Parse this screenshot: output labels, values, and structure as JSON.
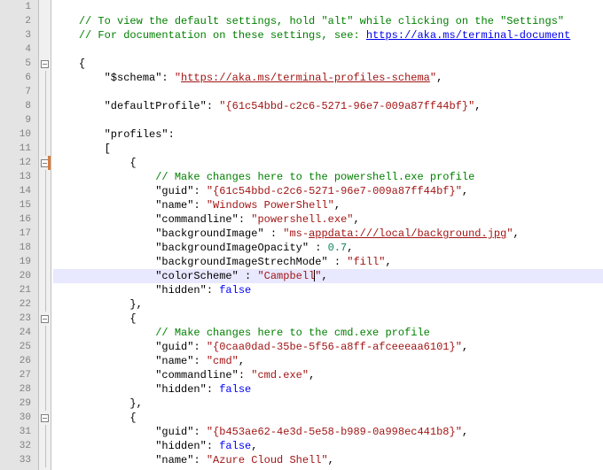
{
  "chart_data": null,
  "lines": [
    {
      "n": 1,
      "fold": "",
      "mark": "",
      "html": ""
    },
    {
      "n": 2,
      "fold": "",
      "mark": "",
      "seg": [
        {
          "cls": "",
          "t": "    "
        },
        {
          "cls": "comment",
          "t": "// To view the default settings, hold \"alt\" while clicking on the \"Settings\""
        }
      ]
    },
    {
      "n": 3,
      "fold": "",
      "mark": "",
      "seg": [
        {
          "cls": "",
          "t": "    "
        },
        {
          "cls": "comment",
          "t": "// For documentation on these settings, see: "
        },
        {
          "cls": "comment link",
          "t": "https://aka.ms/terminal-document"
        }
      ]
    },
    {
      "n": 4,
      "fold": "",
      "mark": "",
      "seg": []
    },
    {
      "n": 5,
      "fold": "box",
      "mark": "",
      "seg": [
        {
          "cls": "",
          "t": "    "
        },
        {
          "cls": "punct",
          "t": "{"
        }
      ]
    },
    {
      "n": 6,
      "fold": "line",
      "mark": "",
      "seg": [
        {
          "cls": "",
          "t": "        "
        },
        {
          "cls": "key",
          "t": "\"$schema\""
        },
        {
          "cls": "punct",
          "t": ": "
        },
        {
          "cls": "str",
          "t": "\""
        },
        {
          "cls": "keylink",
          "t": "https://aka.ms/terminal-profiles-schema"
        },
        {
          "cls": "str",
          "t": "\""
        },
        {
          "cls": "punct",
          "t": ","
        }
      ]
    },
    {
      "n": 7,
      "fold": "line",
      "mark": "",
      "seg": []
    },
    {
      "n": 8,
      "fold": "line",
      "mark": "",
      "seg": [
        {
          "cls": "",
          "t": "        "
        },
        {
          "cls": "key",
          "t": "\"defaultProfile\""
        },
        {
          "cls": "punct",
          "t": ": "
        },
        {
          "cls": "str",
          "t": "\"{61c54bbd-c2c6-5271-96e7-009a87ff44bf}\""
        },
        {
          "cls": "punct",
          "t": ","
        }
      ]
    },
    {
      "n": 9,
      "fold": "line",
      "mark": "",
      "seg": []
    },
    {
      "n": 10,
      "fold": "line",
      "mark": "",
      "seg": [
        {
          "cls": "",
          "t": "        "
        },
        {
          "cls": "key",
          "t": "\"profiles\""
        },
        {
          "cls": "punct",
          "t": ":"
        }
      ]
    },
    {
      "n": 11,
      "fold": "line",
      "mark": "",
      "seg": [
        {
          "cls": "",
          "t": "        "
        },
        {
          "cls": "punct",
          "t": "["
        }
      ]
    },
    {
      "n": 12,
      "fold": "box",
      "mark": "changed",
      "seg": [
        {
          "cls": "",
          "t": "            "
        },
        {
          "cls": "punct",
          "t": "{"
        }
      ]
    },
    {
      "n": 13,
      "fold": "line",
      "mark": "",
      "seg": [
        {
          "cls": "",
          "t": "                "
        },
        {
          "cls": "comment",
          "t": "// Make changes here to the powershell.exe profile"
        }
      ]
    },
    {
      "n": 14,
      "fold": "line",
      "mark": "",
      "seg": [
        {
          "cls": "",
          "t": "                "
        },
        {
          "cls": "key",
          "t": "\"guid\""
        },
        {
          "cls": "punct",
          "t": ": "
        },
        {
          "cls": "str",
          "t": "\"{61c54bbd-c2c6-5271-96e7-009a87ff44bf}\""
        },
        {
          "cls": "punct",
          "t": ","
        }
      ]
    },
    {
      "n": 15,
      "fold": "line",
      "mark": "",
      "seg": [
        {
          "cls": "",
          "t": "                "
        },
        {
          "cls": "key",
          "t": "\"name\""
        },
        {
          "cls": "punct",
          "t": ": "
        },
        {
          "cls": "str",
          "t": "\"Windows PowerShell\""
        },
        {
          "cls": "punct",
          "t": ","
        }
      ]
    },
    {
      "n": 16,
      "fold": "line",
      "mark": "",
      "seg": [
        {
          "cls": "",
          "t": "                "
        },
        {
          "cls": "key",
          "t": "\"commandline\""
        },
        {
          "cls": "punct",
          "t": ": "
        },
        {
          "cls": "str",
          "t": "\"powershell.exe\""
        },
        {
          "cls": "punct",
          "t": ","
        }
      ]
    },
    {
      "n": 17,
      "fold": "line",
      "mark": "",
      "seg": [
        {
          "cls": "",
          "t": "                "
        },
        {
          "cls": "key",
          "t": "\"backgroundImage\""
        },
        {
          "cls": "punct",
          "t": " : "
        },
        {
          "cls": "str",
          "t": "\"ms-"
        },
        {
          "cls": "keylink",
          "t": "appdata:///local/background.jpg"
        },
        {
          "cls": "str",
          "t": "\""
        },
        {
          "cls": "punct",
          "t": ","
        }
      ]
    },
    {
      "n": 18,
      "fold": "line",
      "mark": "",
      "seg": [
        {
          "cls": "",
          "t": "                "
        },
        {
          "cls": "key",
          "t": "\"backgroundImageOpacity\""
        },
        {
          "cls": "punct",
          "t": " : "
        },
        {
          "cls": "num",
          "t": "0.7"
        },
        {
          "cls": "punct",
          "t": ","
        }
      ]
    },
    {
      "n": 19,
      "fold": "line",
      "mark": "",
      "seg": [
        {
          "cls": "",
          "t": "                "
        },
        {
          "cls": "key",
          "t": "\"backgroundImageStrechMode\""
        },
        {
          "cls": "punct",
          "t": " : "
        },
        {
          "cls": "str",
          "t": "\"fill\""
        },
        {
          "cls": "punct",
          "t": ","
        }
      ]
    },
    {
      "n": 20,
      "fold": "line",
      "mark": "",
      "hl": true,
      "caret": true,
      "seg": [
        {
          "cls": "",
          "t": "                "
        },
        {
          "cls": "key",
          "t": "\"colorScheme\""
        },
        {
          "cls": "punct",
          "t": " : "
        },
        {
          "cls": "str",
          "t": "\"Campbell"
        },
        {
          "cls": "caretmark",
          "t": ""
        },
        {
          "cls": "str",
          "t": "\""
        },
        {
          "cls": "punct",
          "t": ","
        }
      ]
    },
    {
      "n": 21,
      "fold": "line",
      "mark": "",
      "seg": [
        {
          "cls": "",
          "t": "                "
        },
        {
          "cls": "key",
          "t": "\"hidden\""
        },
        {
          "cls": "punct",
          "t": ": "
        },
        {
          "cls": "bool",
          "t": "false"
        }
      ]
    },
    {
      "n": 22,
      "fold": "line",
      "mark": "",
      "seg": [
        {
          "cls": "",
          "t": "            "
        },
        {
          "cls": "punct",
          "t": "},"
        }
      ]
    },
    {
      "n": 23,
      "fold": "box",
      "mark": "",
      "seg": [
        {
          "cls": "",
          "t": "            "
        },
        {
          "cls": "punct",
          "t": "{"
        }
      ]
    },
    {
      "n": 24,
      "fold": "line",
      "mark": "",
      "seg": [
        {
          "cls": "",
          "t": "                "
        },
        {
          "cls": "comment",
          "t": "// Make changes here to the cmd.exe profile"
        }
      ]
    },
    {
      "n": 25,
      "fold": "line",
      "mark": "",
      "seg": [
        {
          "cls": "",
          "t": "                "
        },
        {
          "cls": "key",
          "t": "\"guid\""
        },
        {
          "cls": "punct",
          "t": ": "
        },
        {
          "cls": "str",
          "t": "\"{0caa0dad-35be-5f56-a8ff-afceeeaa6101}\""
        },
        {
          "cls": "punct",
          "t": ","
        }
      ]
    },
    {
      "n": 26,
      "fold": "line",
      "mark": "",
      "seg": [
        {
          "cls": "",
          "t": "                "
        },
        {
          "cls": "key",
          "t": "\"name\""
        },
        {
          "cls": "punct",
          "t": ": "
        },
        {
          "cls": "str",
          "t": "\"cmd\""
        },
        {
          "cls": "punct",
          "t": ","
        }
      ]
    },
    {
      "n": 27,
      "fold": "line",
      "mark": "",
      "seg": [
        {
          "cls": "",
          "t": "                "
        },
        {
          "cls": "key",
          "t": "\"commandline\""
        },
        {
          "cls": "punct",
          "t": ": "
        },
        {
          "cls": "str",
          "t": "\"cmd.exe\""
        },
        {
          "cls": "punct",
          "t": ","
        }
      ]
    },
    {
      "n": 28,
      "fold": "line",
      "mark": "",
      "seg": [
        {
          "cls": "",
          "t": "                "
        },
        {
          "cls": "key",
          "t": "\"hidden\""
        },
        {
          "cls": "punct",
          "t": ": "
        },
        {
          "cls": "bool",
          "t": "false"
        }
      ]
    },
    {
      "n": 29,
      "fold": "line",
      "mark": "",
      "seg": [
        {
          "cls": "",
          "t": "            "
        },
        {
          "cls": "punct",
          "t": "},"
        }
      ]
    },
    {
      "n": 30,
      "fold": "box",
      "mark": "",
      "seg": [
        {
          "cls": "",
          "t": "            "
        },
        {
          "cls": "punct",
          "t": "{"
        }
      ]
    },
    {
      "n": 31,
      "fold": "line",
      "mark": "",
      "seg": [
        {
          "cls": "",
          "t": "                "
        },
        {
          "cls": "key",
          "t": "\"guid\""
        },
        {
          "cls": "punct",
          "t": ": "
        },
        {
          "cls": "str",
          "t": "\"{b453ae62-4e3d-5e58-b989-0a998ec441b8}\""
        },
        {
          "cls": "punct",
          "t": ","
        }
      ]
    },
    {
      "n": 32,
      "fold": "line",
      "mark": "",
      "seg": [
        {
          "cls": "",
          "t": "                "
        },
        {
          "cls": "key",
          "t": "\"hidden\""
        },
        {
          "cls": "punct",
          "t": ": "
        },
        {
          "cls": "bool",
          "t": "false"
        },
        {
          "cls": "punct",
          "t": ","
        }
      ]
    },
    {
      "n": 33,
      "fold": "line",
      "mark": "",
      "seg": [
        {
          "cls": "",
          "t": "                "
        },
        {
          "cls": "key",
          "t": "\"name\""
        },
        {
          "cls": "punct",
          "t": ": "
        },
        {
          "cls": "str",
          "t": "\"Azure Cloud Shell\""
        },
        {
          "cls": "punct",
          "t": ","
        }
      ]
    }
  ]
}
